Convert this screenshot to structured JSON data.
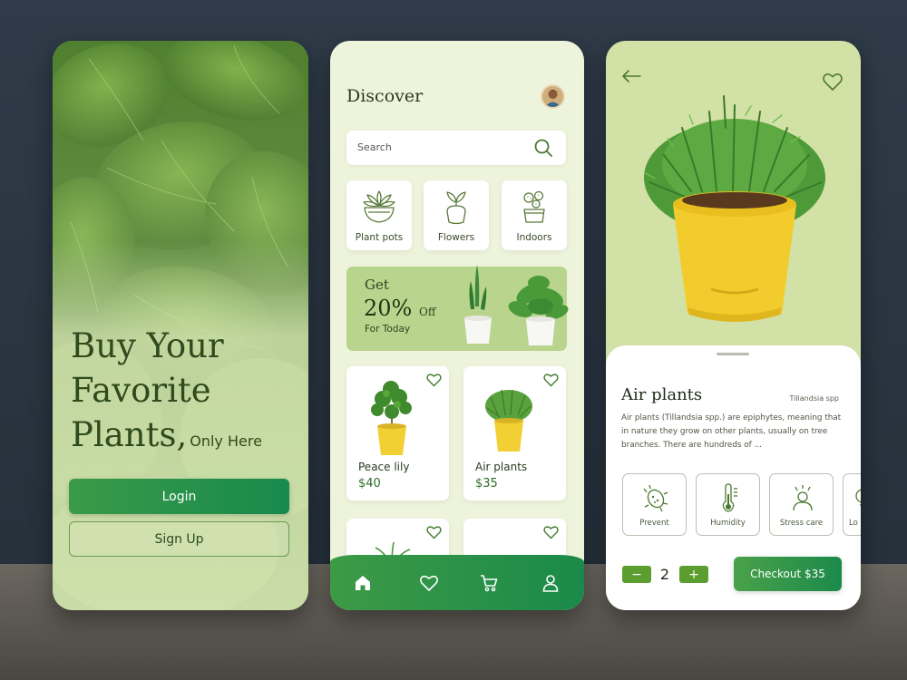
{
  "colors": {
    "brand_green": "#1b8a4a",
    "light_green": "#d2e1a6",
    "soft_background": "#eef3dc",
    "dark_text": "#1f2a18"
  },
  "phone1": {
    "headline_line1": "Buy Your",
    "headline_line2": "Favorite",
    "headline_line3": "Plants,",
    "headline_sub": "Only Here",
    "login_label": "Login",
    "signup_label": "Sign Up"
  },
  "phone2": {
    "title": "Discover",
    "avatar_icon": "user-avatar",
    "search": {
      "placeholder": "Search",
      "icon": "search-icon"
    },
    "categories": [
      {
        "label": "Plant pots",
        "icon": "succulent-pot-icon"
      },
      {
        "label": "Flowers",
        "icon": "leaf-pot-icon"
      },
      {
        "label": "Indoors",
        "icon": "cactus-pot-icon"
      }
    ],
    "promo": {
      "get": "Get",
      "percent": "20%",
      "off": "Off",
      "subtitle": "For Today"
    },
    "products": [
      {
        "name": "Peace lily",
        "price": "$40"
      },
      {
        "name": "Air plants",
        "price": "$35"
      },
      {
        "name": "",
        "price": ""
      },
      {
        "name": "",
        "price": ""
      }
    ],
    "nav": [
      "home-icon",
      "heart-icon",
      "cart-icon",
      "profile-icon"
    ]
  },
  "phone3": {
    "product_name": "Air plants",
    "latin_name": "Tillandsia spp",
    "description": "Air plants (Tillandsia spp.) are epiphytes, meaning that in nature they grow on other plants, usually on tree branches. There are hundreds of ...",
    "care_items": [
      {
        "label": "Prevent",
        "icon": "bug-icon"
      },
      {
        "label": "Humidity",
        "icon": "thermometer-icon"
      },
      {
        "label": "Stress care",
        "icon": "stress-care-icon"
      },
      {
        "label": "Lo",
        "icon": "light-icon"
      }
    ],
    "quantity": "2",
    "minus_label": "−",
    "plus_label": "+",
    "checkout_label": "Checkout $35"
  }
}
